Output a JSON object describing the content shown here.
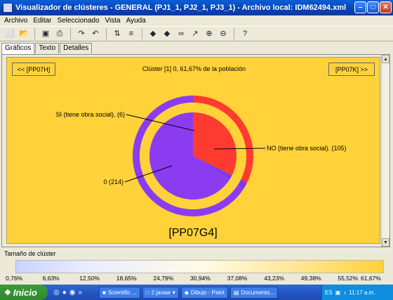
{
  "window": {
    "title": "Visualizador de clústeres - GENERAL (PJ1_1, PJ2_1, PJ3_1) - Archivo local: IDM62494.xml"
  },
  "menu": [
    "Archivo",
    "Editar",
    "Seleccionado",
    "Vista",
    "Ayuda"
  ],
  "toolbar_icons": [
    "new-icon",
    "open-icon",
    "save-icon",
    "print-icon",
    "redo-icon",
    "undo-icon",
    "sort-icon",
    "filter-icon",
    "arrow-left-icon",
    "arrow-right-icon",
    "binoculars-icon",
    "chart-icon",
    "zoom-in-icon",
    "zoom-out-icon",
    "help-icon"
  ],
  "tabs": [
    "Gráficos",
    "Texto",
    "Detalles"
  ],
  "plot": {
    "prev_button": "<< [PP07H]",
    "next_button": "[PP07K] >>",
    "title": "Clúster [1] 0, 61,67% de la población",
    "variable_label": "[PP07G4]",
    "background": "#ffd23a",
    "colors": {
      "no": "#ff3b30",
      "si": "#7c3aed",
      "zero": "#8b3cf0",
      "gap": "#ffd23a"
    }
  },
  "chart_data": {
    "type": "pie",
    "categories": [
      "NO (tiene obra social).",
      "SI (tiene obra social).",
      "0"
    ],
    "values": [
      105,
      6,
      214
    ],
    "labels": [
      "NO (tiene obra social). (105)",
      "SI (tiene obra social). (6)",
      "0 (214)"
    ],
    "title": "Clúster [1] 0, 61,67% de la población"
  },
  "size_panel": {
    "label": "Tamaño de clúster",
    "ticks": [
      "0,76%",
      "6,63%",
      "12,50%",
      "18,65%",
      "24,79%",
      "30,94%",
      "37,08%",
      "43,23%",
      "49,38%",
      "55,52%",
      "61,67%"
    ]
  },
  "taskbar": {
    "start": "Inicio",
    "tasks": [
      "Scientific ...",
      "2 javaw",
      "Dibujo - Paint",
      "Documento..."
    ],
    "lang": "ES",
    "clock": "11:17 a.m."
  }
}
